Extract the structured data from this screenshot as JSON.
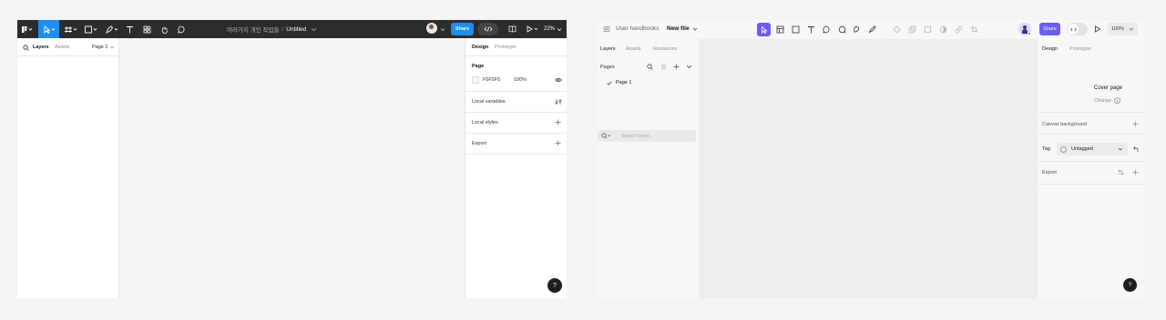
{
  "left_window": {
    "toolbar": {
      "file_path": "여러가지 개인 작업들",
      "separator": "/",
      "file_name": "Untitled",
      "share_label": "Share",
      "zoom": "22%"
    },
    "left_panel": {
      "tabs": [
        "Layers",
        "Assets"
      ],
      "page_selector": "Page 1"
    },
    "right_panel": {
      "tabs": [
        "Design",
        "Prototype"
      ],
      "page_heading": "Page",
      "page_color": "F5F5F5",
      "page_opacity": "100%",
      "sections": [
        "Local variables",
        "Local styles",
        "Export"
      ]
    },
    "help": "?",
    "colors": {
      "toolbar_bg": "#2c2c2c",
      "accent": "#1e8ef0",
      "canvas": "#f5f5f5"
    }
  },
  "right_window": {
    "toolbar": {
      "breadcrumb": "User handbooks",
      "file_name": "New file",
      "share_label": "Share",
      "zoom": "100%"
    },
    "left_panel": {
      "tabs": [
        "Layers",
        "Assets",
        "Resources"
      ],
      "pages_heading": "Pages",
      "pages": [
        "Page 1"
      ],
      "search_placeholder": "Search layers..."
    },
    "right_panel": {
      "tabs": [
        "Design",
        "Prototype"
      ],
      "cover_title": "Cover page",
      "cover_change": "Change",
      "canvas_background": "Canvas background",
      "tag_label": "Tag",
      "tag_value": "Untagged",
      "export_label": "Export"
    },
    "help": "?",
    "colors": {
      "accent": "#6b5cf6",
      "canvas": "#ededed"
    }
  }
}
